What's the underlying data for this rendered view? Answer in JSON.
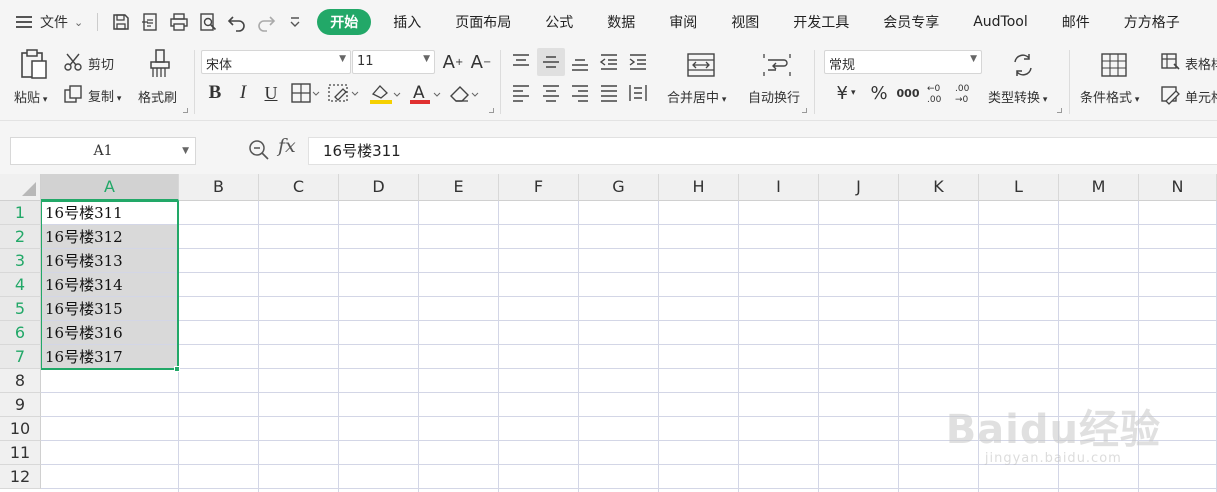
{
  "menubar": {
    "file_label": "文件",
    "tabs": [
      {
        "label": "开始",
        "active": true
      },
      {
        "label": "插入",
        "active": false
      },
      {
        "label": "页面布局",
        "active": false
      },
      {
        "label": "公式",
        "active": false
      },
      {
        "label": "数据",
        "active": false
      },
      {
        "label": "审阅",
        "active": false
      },
      {
        "label": "视图",
        "active": false
      },
      {
        "label": "开发工具",
        "active": false
      },
      {
        "label": "会员专享",
        "active": false
      },
      {
        "label": "AudTool",
        "active": false
      },
      {
        "label": "邮件",
        "active": false
      },
      {
        "label": "方方格子",
        "active": false
      }
    ],
    "accent_color": "#22a868"
  },
  "ribbon": {
    "paste": "粘贴",
    "cut": "剪切",
    "copy": "复制",
    "format_painter": "格式刷",
    "font_name": "宋体",
    "font_size": "11",
    "merge_center": "合并居中",
    "wrap_text": "自动换行",
    "number_format": "常规",
    "type_convert": "类型转换",
    "conditional_format": "条件格式",
    "table_style": "表格样",
    "cell_style": "单元格",
    "font_color": "#e03030",
    "highlight_color": "#f5d000"
  },
  "formula_bar": {
    "name_box": "A1",
    "fx": "fx",
    "value": "16号楼311"
  },
  "grid": {
    "columns": [
      "A",
      "B",
      "C",
      "D",
      "E",
      "F",
      "G",
      "H",
      "I",
      "J",
      "K",
      "L",
      "M",
      "N"
    ],
    "selected_column": "A",
    "rows": [
      "1",
      "2",
      "3",
      "4",
      "5",
      "6",
      "7",
      "8",
      "9",
      "10",
      "11",
      "12"
    ],
    "column_a_values": [
      "16号楼311",
      "16号楼312",
      "16号楼313",
      "16号楼314",
      "16号楼315",
      "16号楼316",
      "16号楼317"
    ]
  },
  "watermark": {
    "logo": "Baidu经验",
    "url": "jingyan.baidu.com"
  }
}
